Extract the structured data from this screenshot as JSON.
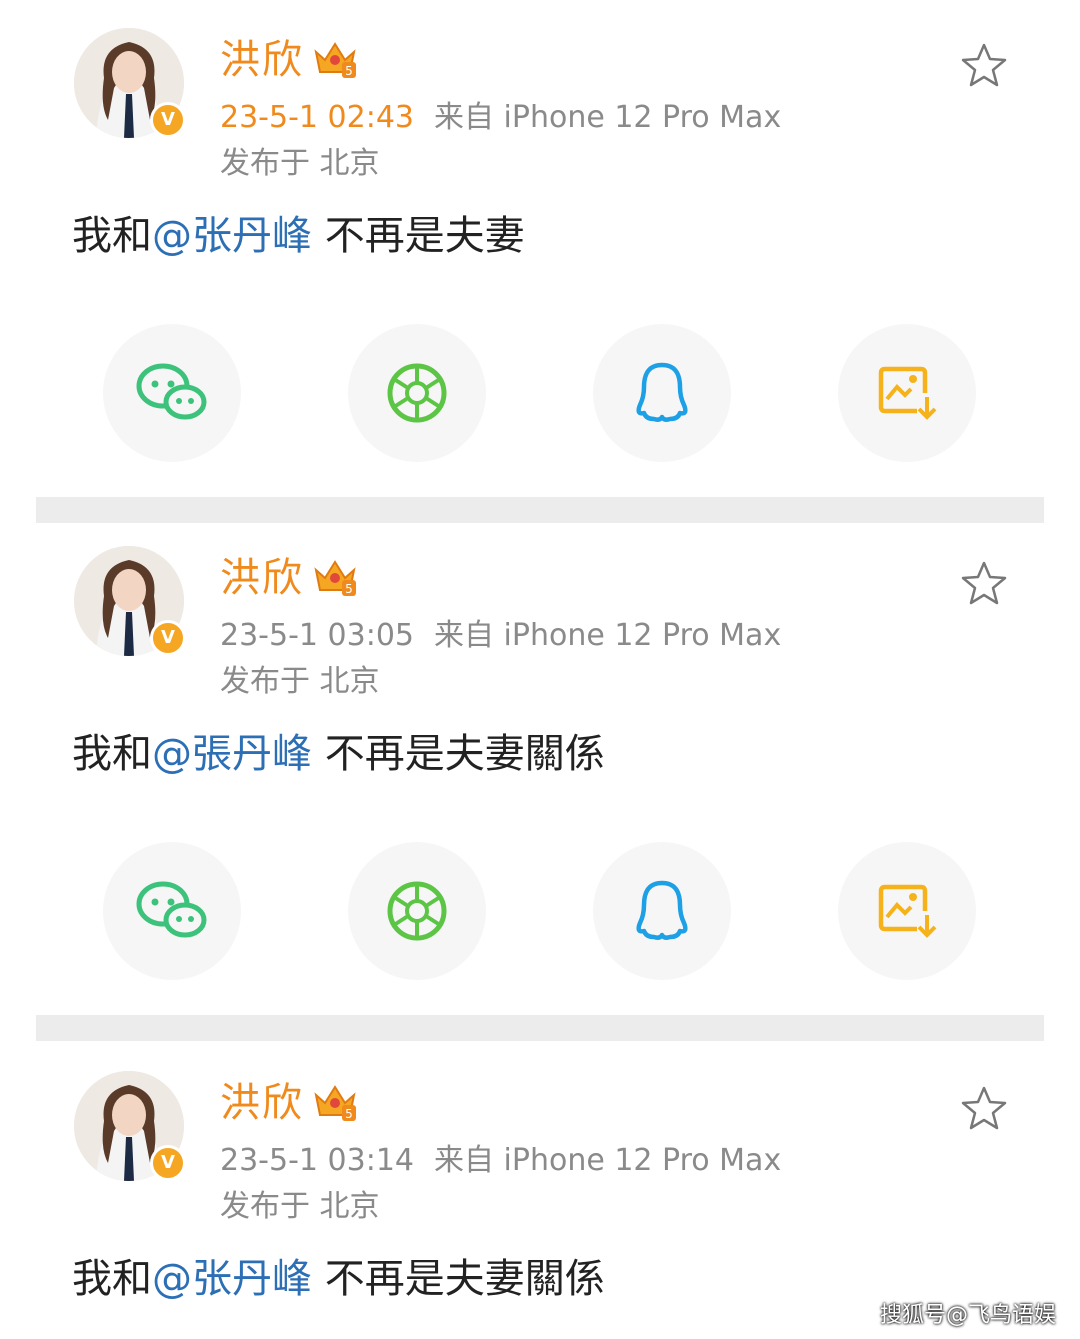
{
  "posts": [
    {
      "name": "洪欣",
      "time": "23-5-1 02:43",
      "time_highlight": true,
      "source": "来自 iPhone 12 Pro Max",
      "location": "发布于 北京",
      "text_before": "我和",
      "mention": "@张丹峰",
      "text_after": " 不再是夫妻"
    },
    {
      "name": "洪欣",
      "time": "23-5-1 03:05",
      "time_highlight": false,
      "source": "来自 iPhone 12 Pro Max",
      "location": "发布于 北京",
      "text_before": "我和",
      "mention": "@張丹峰",
      "text_after": " 不再是夫妻關係"
    },
    {
      "name": "洪欣",
      "time": "23-5-1 03:14",
      "time_highlight": false,
      "source": "来自 iPhone 12 Pro Max",
      "location": "发布于 北京",
      "text_before": "我和",
      "mention": "@张丹峰",
      "text_after": " 不再是夫妻關係"
    }
  ],
  "share_icons": [
    "wechat-icon",
    "moments-icon",
    "qq-icon",
    "save-image-icon"
  ],
  "colors": {
    "name": "#f08a1c",
    "mention": "#2d6fb5",
    "wechat": "#3cc27a",
    "moments": "#5dc545",
    "qq": "#1ea0e6",
    "save": "#f5b21a"
  },
  "watermark": "搜狐号@飞鸟语娱"
}
